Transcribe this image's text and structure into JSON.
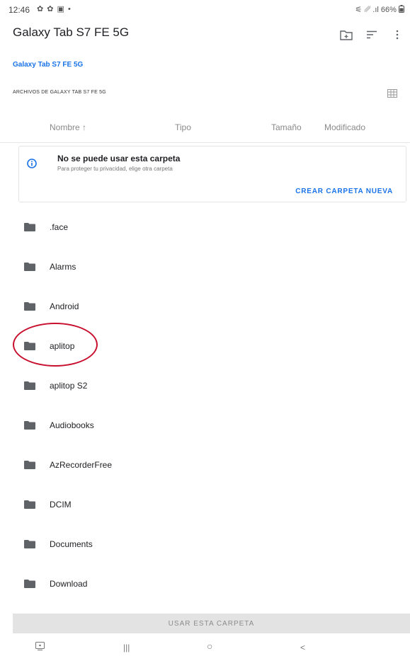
{
  "status_bar": {
    "time": "12:46",
    "left_icons": "✿ ✿ ▣ •",
    "right_text": "⚟ ␥ .ıl 66%",
    "battery_icon": "battery-icon"
  },
  "app_bar": {
    "title": "Galaxy Tab S7 FE 5G",
    "icons": [
      "new-folder-icon",
      "sort-icon",
      "more-vert-icon"
    ]
  },
  "breadcrumb": "Galaxy Tab S7 FE 5G",
  "section_label": "ARCHIVOS DE GALAXY TAB S7 FE 5G",
  "columns": {
    "name": "Nombre ↑",
    "type": "Tipo",
    "size": "Tamaño",
    "modified": "Modificado"
  },
  "warning": {
    "title": "No se puede usar esta carpeta",
    "subtitle": "Para proteger tu privacidad, elige otra carpeta",
    "action": "CREAR CARPETA NUEVA"
  },
  "folders": [
    ".face",
    "Alarms",
    "Android",
    "aplitop",
    "aplitop S2",
    "Audiobooks",
    "AzRecorderFree",
    "DCIM",
    "Documents",
    "Download"
  ],
  "highlighted_folder": "aplitop",
  "use_button": "USAR ESTA CARPETA",
  "nav_bar": {
    "recents": "|||",
    "home": "○",
    "back": "<"
  },
  "colors": {
    "accent": "#1a73e8",
    "highlight": "#c8102e",
    "folder": "#5f6368"
  }
}
